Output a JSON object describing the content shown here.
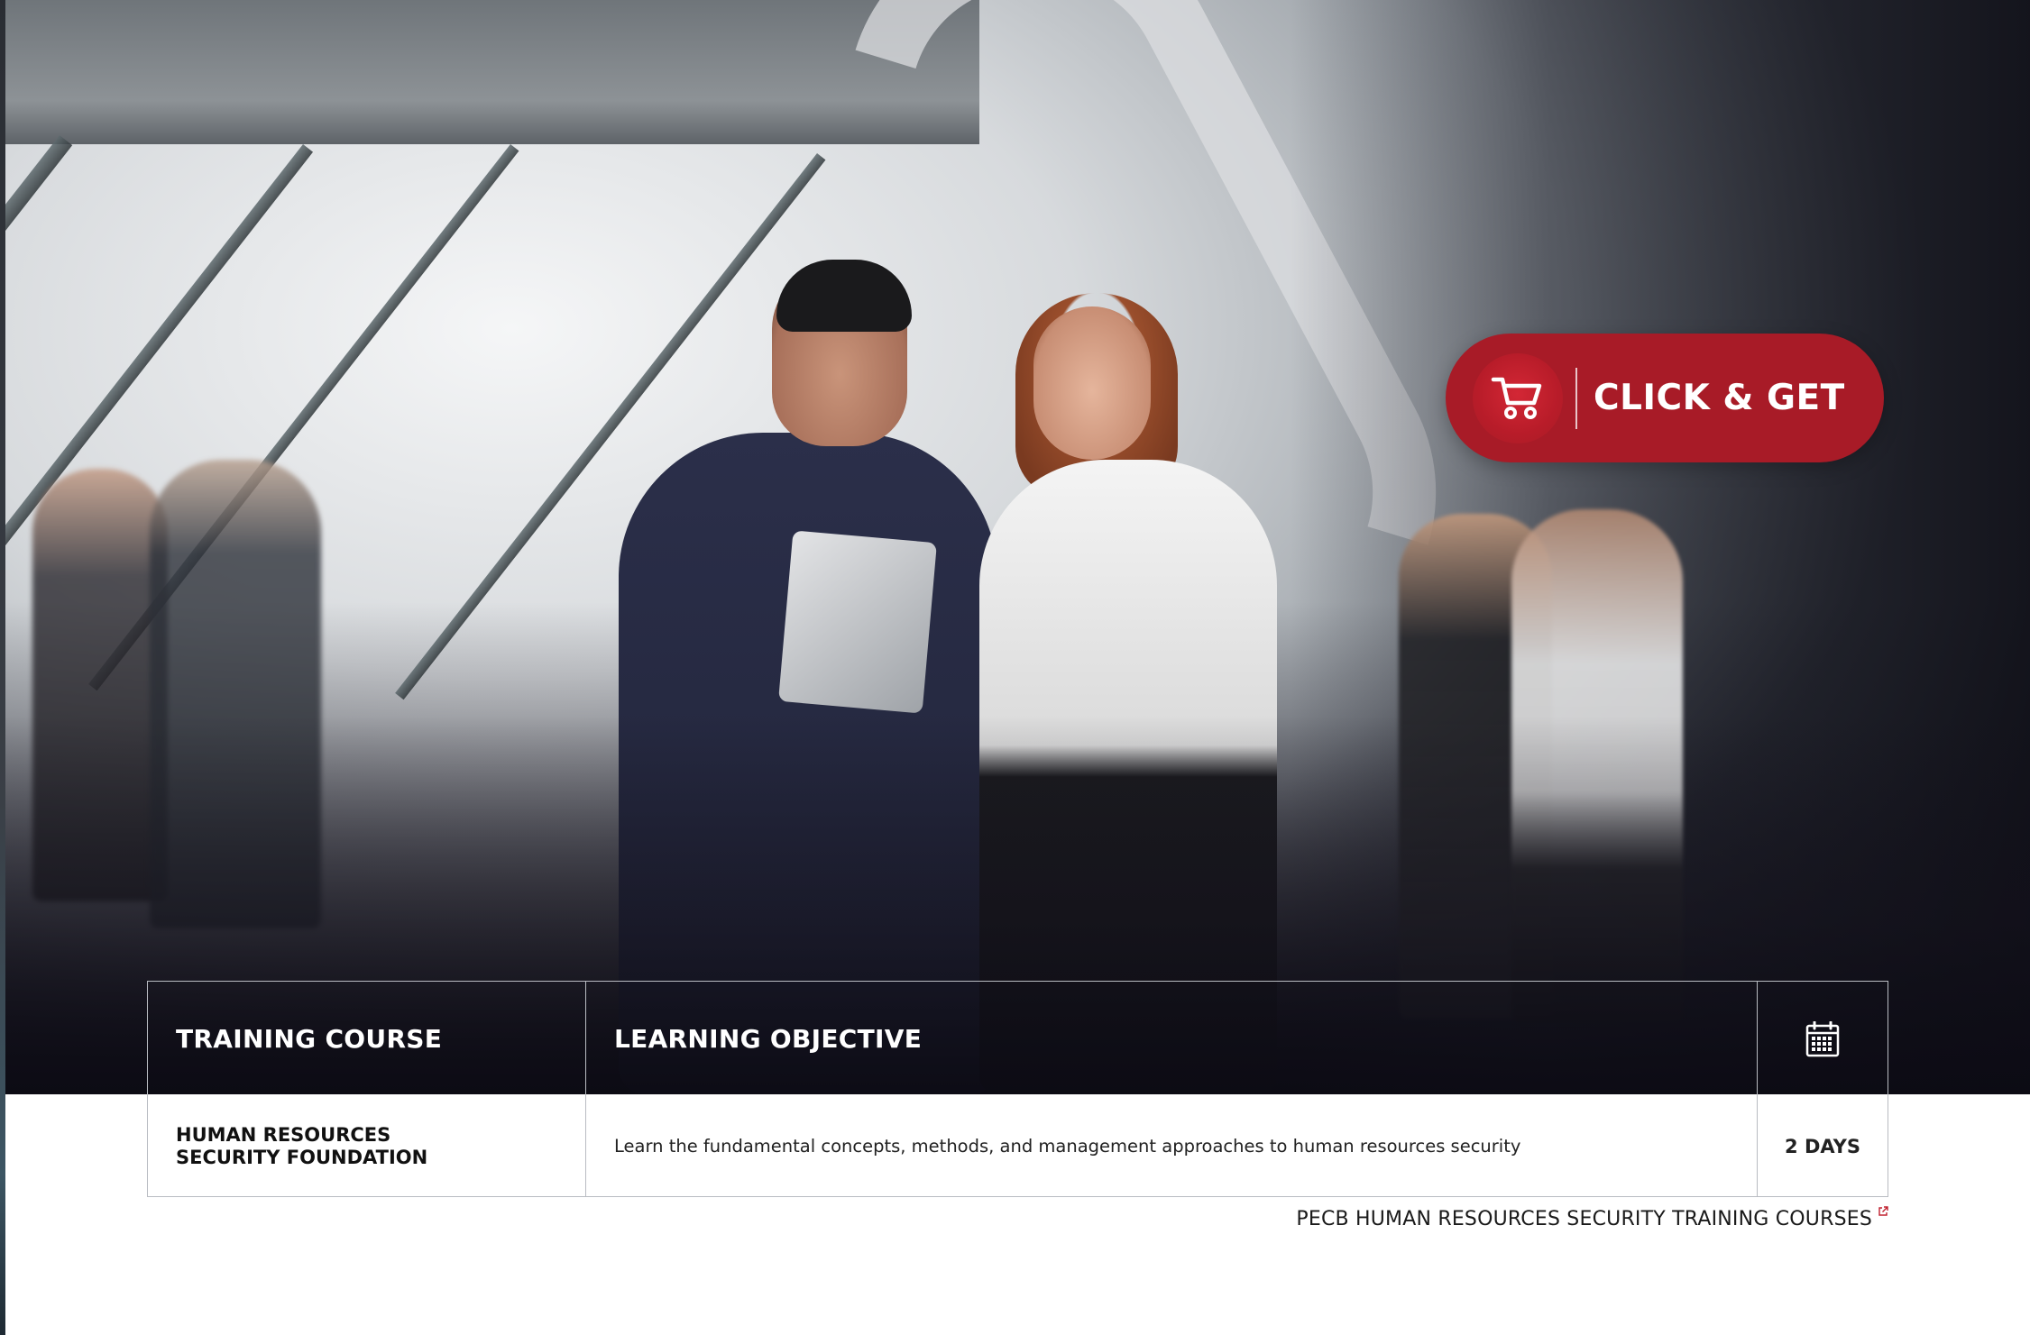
{
  "cta": {
    "label": "CLICK & GET",
    "icon": "shopping-cart-icon",
    "background": "#a81b27"
  },
  "table": {
    "headers": {
      "course": "TRAINING COURSE",
      "objective": "LEARNING OBJECTIVE",
      "duration_icon": "calendar-icon"
    },
    "rows": [
      {
        "course": "HUMAN RESOURCES SECURITY FOUNDATION",
        "objective": "Learn the fundamental concepts, methods, and management approaches to human resources security",
        "duration": "2 DAYS"
      }
    ]
  },
  "footer": {
    "link_label": "PECB HUMAN RESOURCES SECURITY TRAINING COURSES",
    "link_icon": "external-link-icon",
    "link_icon_color": "#c0202e"
  },
  "hero": {
    "image": "office-team-photo"
  }
}
